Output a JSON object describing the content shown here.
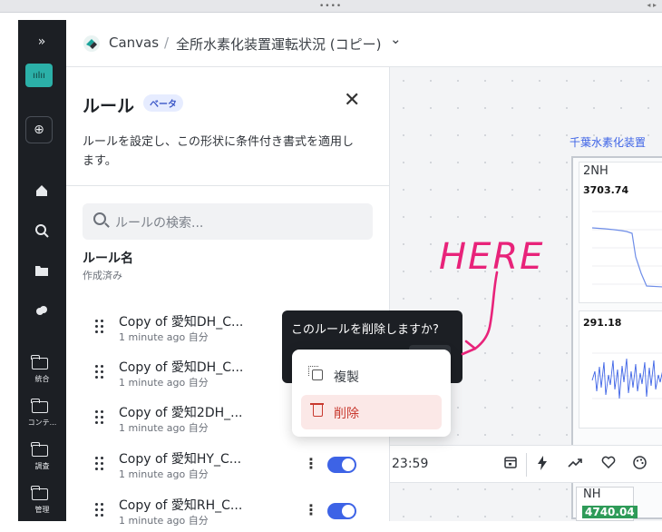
{
  "window": {
    "handle_dots": "••••",
    "arrows": "◂ ▸"
  },
  "sidebar": {
    "expand": "»",
    "items": [
      {
        "label": "統合"
      },
      {
        "label": "コンテ..."
      },
      {
        "label": "調査"
      },
      {
        "label": "管理"
      }
    ]
  },
  "header": {
    "app": "Canvas",
    "separator": "/",
    "title": "全所水素化装置運転状況 (コピー)",
    "chevron": "⌄"
  },
  "panel": {
    "title": "ルール",
    "beta": "ベータ",
    "close": "✕",
    "description": "ルールを設定し、この形状に条件付き書式を適用します。",
    "search_placeholder": "ルールの検索...",
    "rule_name_header": "ルール名",
    "rule_name_sub": "作成済み",
    "rules": [
      {
        "name": "Copy of 愛知DH_C...",
        "meta": "1 minute ago 自分"
      },
      {
        "name": "Copy of 愛知DH_C...",
        "meta": "1 minute ago 自分"
      },
      {
        "name": "Copy of 愛知2DH_...",
        "meta": "1 minute ago 自分"
      },
      {
        "name": "Copy of 愛知HY_C...",
        "meta": "1 minute ago 自分"
      },
      {
        "name": "Copy of 愛知RH_C...",
        "meta": "1 minute ago 自分"
      }
    ]
  },
  "tooltip": {
    "text": "このルールを削除しますか?"
  },
  "context_menu": {
    "duplicate": "複製",
    "delete": "削除"
  },
  "annotation": {
    "text": "HERE"
  },
  "canvas": {
    "plant_title": "千葉水素化装置",
    "cards": [
      {
        "label": "2NH",
        "value": "3703.74"
      },
      {
        "label": "",
        "value": "291.18"
      }
    ],
    "bottom_card": {
      "label": "NH",
      "value": "4740.04"
    },
    "time": "23:59"
  },
  "colors": {
    "accent": "#3d63e6",
    "danger": "#c8392f",
    "annotation": "#e8237a",
    "sidebar": "#1c1f24"
  }
}
